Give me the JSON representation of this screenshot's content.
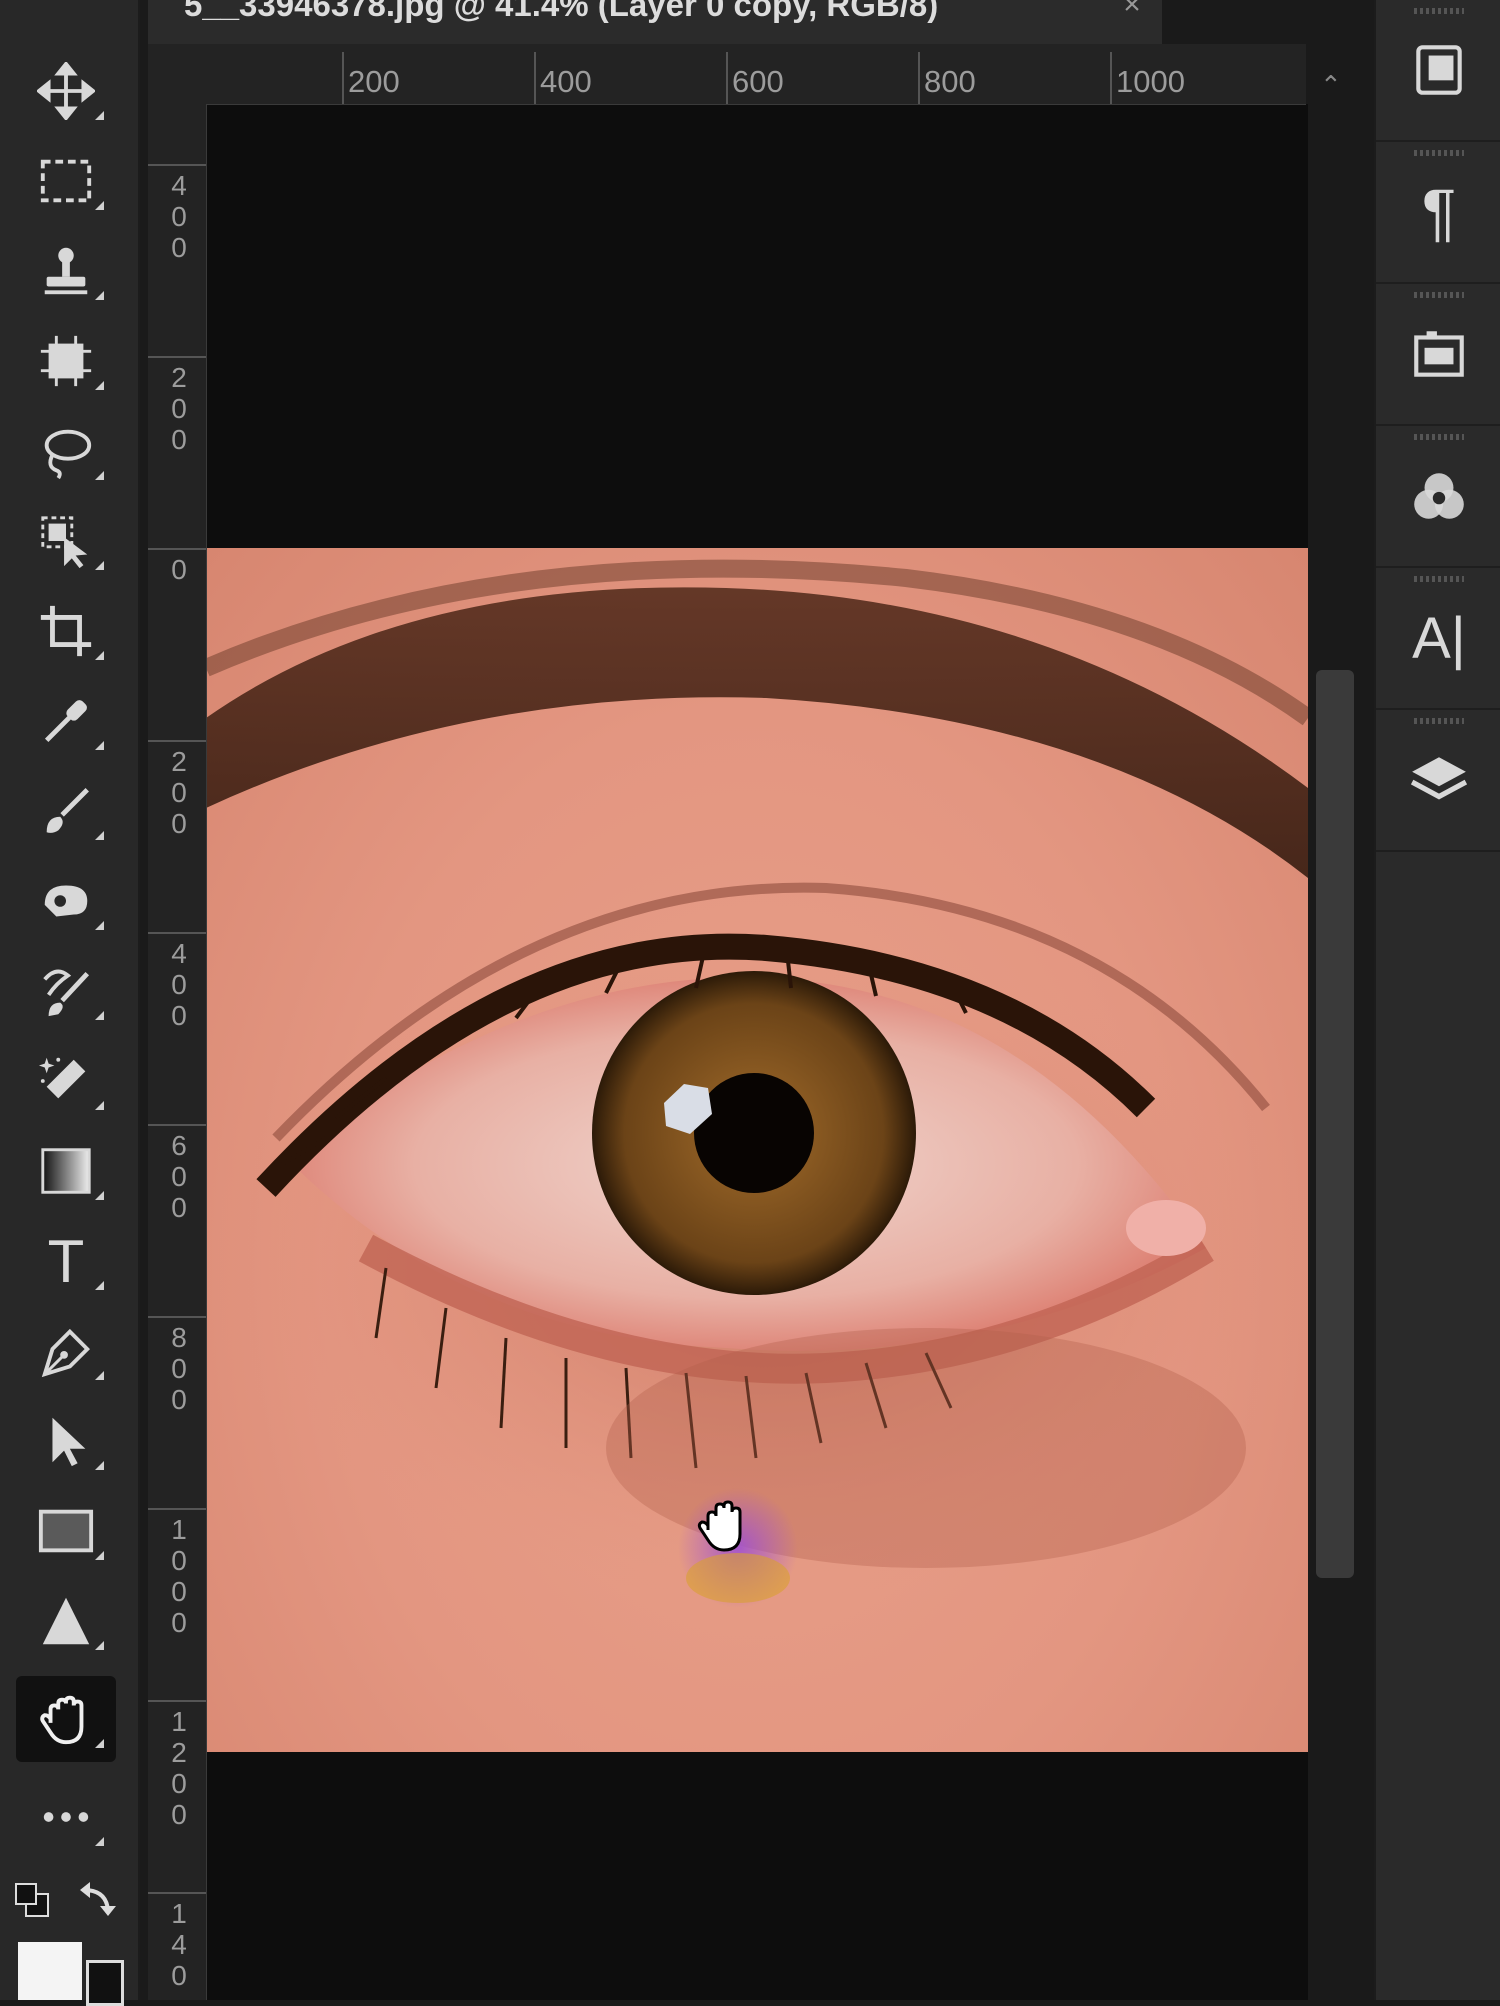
{
  "document": {
    "tab_title": "5__33946378.jpg @ 41.4% (Layer 0 copy, RGB/8)",
    "close_glyph": "×"
  },
  "ruler_horizontal": [
    "200",
    "400",
    "600",
    "800",
    "1000"
  ],
  "ruler_vertical": [
    [
      "4",
      "0",
      "0"
    ],
    [
      "2",
      "0",
      "0"
    ],
    [
      "0"
    ],
    [
      "2",
      "0",
      "0"
    ],
    [
      "4",
      "0",
      "0"
    ],
    [
      "6",
      "0",
      "0"
    ],
    [
      "8",
      "0",
      "0"
    ],
    [
      "1",
      "0",
      "0",
      "0"
    ],
    [
      "1",
      "2",
      "0",
      "0"
    ],
    [
      "1",
      "4",
      "0"
    ]
  ],
  "tools": [
    {
      "name": "move-tool-icon"
    },
    {
      "name": "marquee-tool-icon"
    },
    {
      "name": "stamp-tool-icon"
    },
    {
      "name": "artboard-tool-icon"
    },
    {
      "name": "lasso-tool-icon"
    },
    {
      "name": "object-select-tool-icon"
    },
    {
      "name": "crop-tool-icon"
    },
    {
      "name": "eyedropper-tool-icon"
    },
    {
      "name": "brush-tool-icon"
    },
    {
      "name": "healing-tool-icon"
    },
    {
      "name": "mixer-brush-tool-icon"
    },
    {
      "name": "eraser-tool-icon"
    },
    {
      "name": "gradient-tool-icon"
    },
    {
      "name": "type-tool-icon"
    },
    {
      "name": "pen-tool-icon"
    },
    {
      "name": "path-select-tool-icon"
    },
    {
      "name": "rectangle-tool-icon"
    },
    {
      "name": "shape-tool-icon"
    },
    {
      "name": "hand-tool-icon",
      "active": true
    },
    {
      "name": "more-tools-icon"
    }
  ],
  "right_panels": [
    {
      "name": "library-panel-icon"
    },
    {
      "name": "paragraph-panel-icon",
      "glyph": "¶"
    },
    {
      "name": "briefcase-panel-icon"
    },
    {
      "name": "channels-panel-icon"
    },
    {
      "name": "character-panel-icon",
      "glyph": "A|"
    },
    {
      "name": "layers-panel-icon"
    }
  ],
  "colors": {
    "ui_bg": "#282828",
    "canvas_bg": "#0d0d0d",
    "skin": "#e39681",
    "iris": "#7a4a1c"
  },
  "type_tool_glyph": "T"
}
